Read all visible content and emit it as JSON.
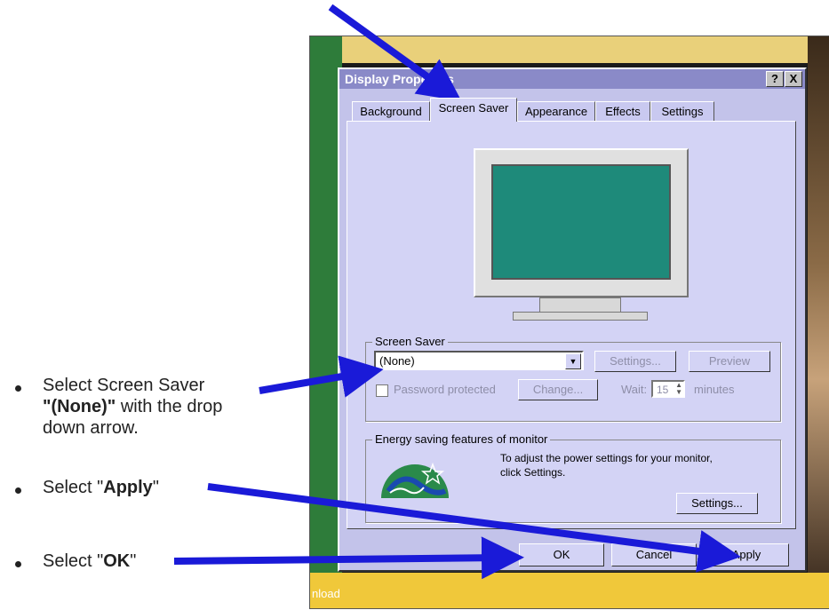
{
  "instructions": [
    {
      "parts": [
        "Select Screen Saver",
        "\"(None)\"",
        "with the drop",
        "down arrow."
      ]
    },
    {
      "prefix": "Select \"",
      "bold": "Apply",
      "suffix": "\""
    },
    {
      "prefix": "Select \"",
      "bold": "OK",
      "suffix": "\""
    }
  ],
  "desktop": {
    "download_label": "nload"
  },
  "dialog": {
    "title": "Display Properties",
    "help_label": "?",
    "close_label": "X",
    "tabs": [
      "Background",
      "Screen Saver",
      "Appearance",
      "Effects",
      "Settings"
    ],
    "active_tab": "Screen Saver",
    "screen_saver": {
      "group_label": "Screen Saver",
      "selected": "(None)",
      "settings_label": "Settings...",
      "preview_label": "Preview",
      "password_label": "Password protected",
      "change_label": "Change...",
      "wait_label": "Wait:",
      "wait_value": "15",
      "minutes_label": "minutes"
    },
    "energy": {
      "group_label": "Energy saving features of monitor",
      "text_line1": "To adjust the power settings for your monitor,",
      "text_line2": "click Settings.",
      "settings_label": "Settings..."
    },
    "buttons": {
      "ok": "OK",
      "cancel": "Cancel",
      "apply": "Apply"
    }
  },
  "colors": {
    "arrow": "#1a1ad8",
    "dialog_bg": "#c3c3ea",
    "screen": "#1e8a7a"
  }
}
